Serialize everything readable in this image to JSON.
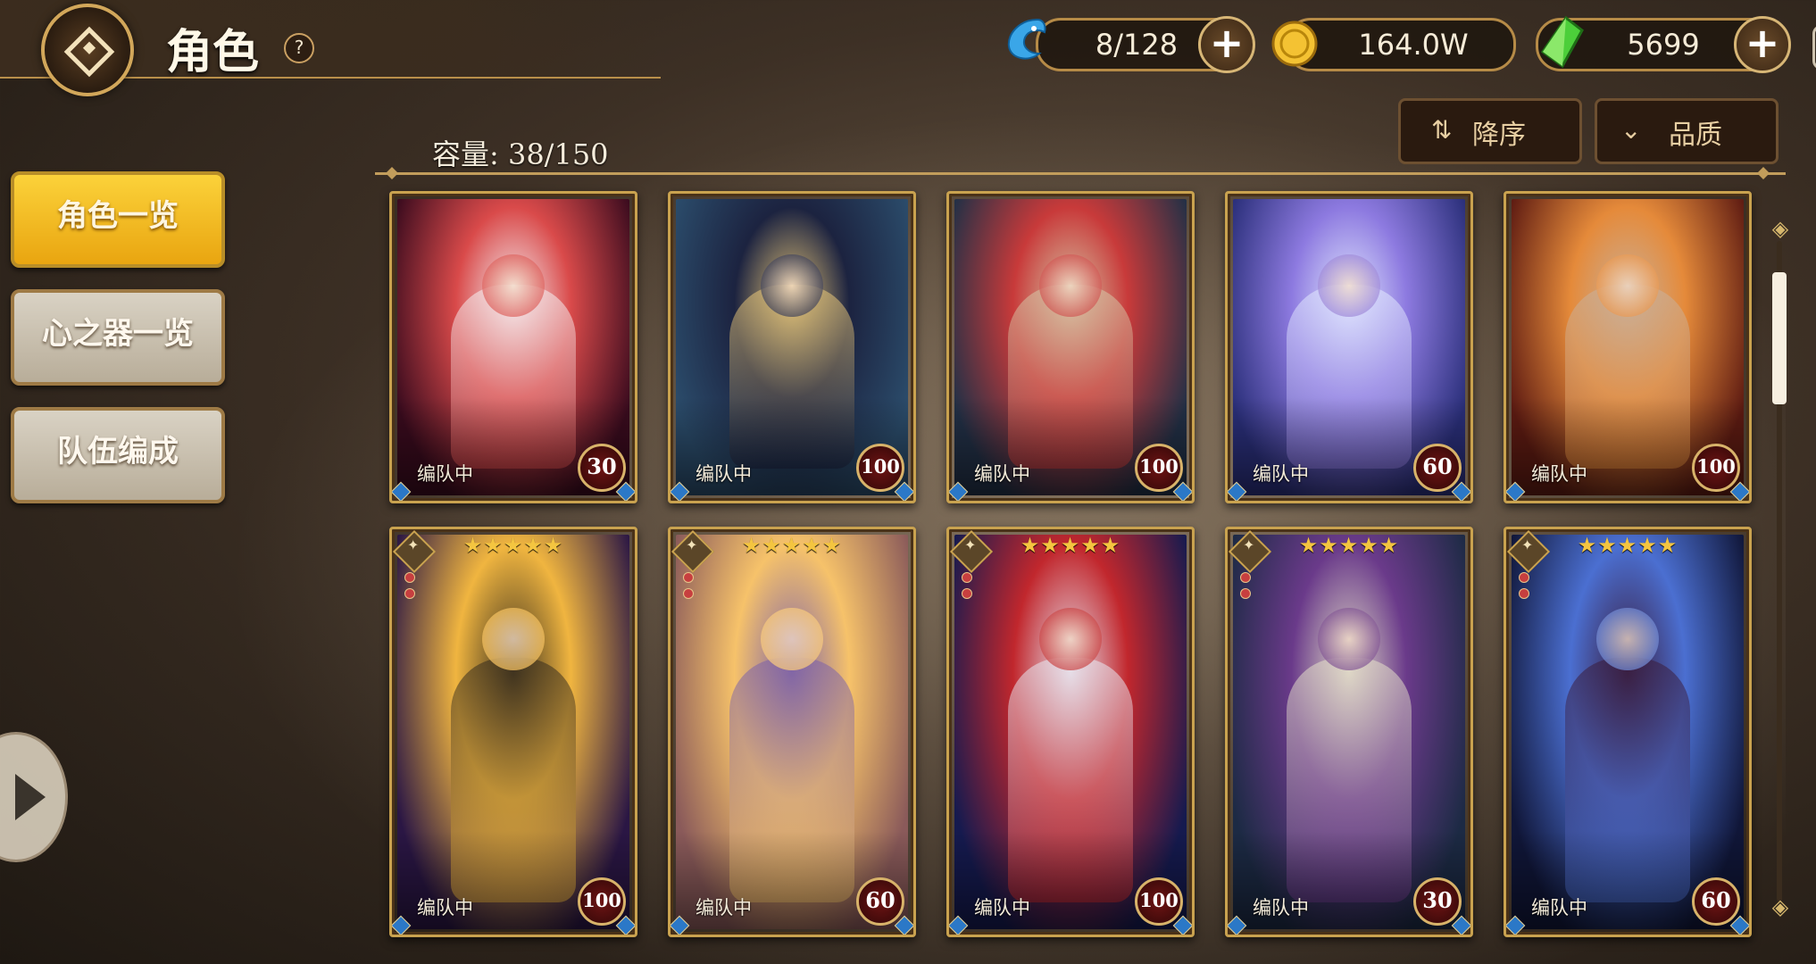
{
  "header": {
    "title": "角色",
    "help": "?"
  },
  "currencies": [
    {
      "name": "stamina",
      "value": "8/128",
      "icon": "blue-fish-icon"
    },
    {
      "name": "gold",
      "value": "164.0W",
      "icon": "gold-coin-icon"
    },
    {
      "name": "gem",
      "value": "5699",
      "icon": "green-crystal-icon"
    }
  ],
  "sort": {
    "order_label": "降序",
    "quality_label": "品质"
  },
  "capacity": "容量: 38/150",
  "menu": [
    {
      "label": "角色一览",
      "active": true
    },
    {
      "label": "心之器一览",
      "active": false
    },
    {
      "label": "队伍编成",
      "active": false
    }
  ],
  "cards": [
    {
      "status": "编队中",
      "level": "30",
      "stars": "",
      "palette": [
        "#3a0b1e",
        "#d94a4a",
        "#f5f0f2"
      ]
    },
    {
      "status": "编队中",
      "level": "100",
      "stars": "",
      "palette": [
        "#2b4c6b",
        "#1c2340",
        "#e8c77a"
      ]
    },
    {
      "status": "编队中",
      "level": "100",
      "stars": "",
      "palette": [
        "#223046",
        "#c83a3a",
        "#d6c6a6"
      ]
    },
    {
      "status": "编队中",
      "level": "60",
      "stars": "",
      "palette": [
        "#2a2f7a",
        "#8d7ae0",
        "#e2e8ff"
      ]
    },
    {
      "status": "编队中",
      "level": "100",
      "stars": "",
      "palette": [
        "#5e1b12",
        "#e58a3a",
        "#c9b09a"
      ]
    },
    {
      "status": "编队中",
      "level": "100",
      "stars": "★★★★★",
      "palette": [
        "#2a1644",
        "#f0b540",
        "#3a2f1e"
      ]
    },
    {
      "status": "编队中",
      "level": "60",
      "stars": "★★★★★",
      "palette": [
        "#8a5a5a",
        "#f6c26a",
        "#7e63a8"
      ]
    },
    {
      "status": "编队中",
      "level": "100",
      "stars": "★★★★★",
      "palette": [
        "#151a4f",
        "#c1272d",
        "#e7e4ee"
      ]
    },
    {
      "status": "编队中",
      "level": "30",
      "stars": "★★★★★",
      "palette": [
        "#1c2a44",
        "#6a3a8a",
        "#e2dcc8"
      ]
    },
    {
      "status": "编队中",
      "level": "60",
      "stars": "★★★★★",
      "palette": [
        "#101638",
        "#4b6fd1",
        "#3a1d3e"
      ]
    }
  ]
}
